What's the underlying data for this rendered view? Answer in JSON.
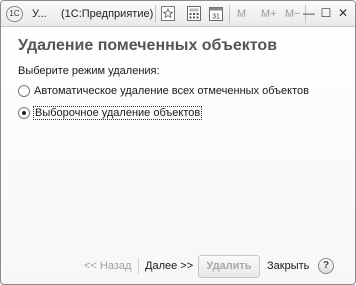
{
  "titlebar": {
    "logo": "1С",
    "short_title": "У...",
    "app_name": "(1С:Предприятие)",
    "m_label": "M",
    "m_plus_label": "M+",
    "m_minus_label": "M−",
    "min_symbol": "—",
    "max_symbol": "☐",
    "close_symbol": "✕",
    "icons": [
      "favorites-star-icon",
      "calculator-icon",
      "calendar-icon"
    ]
  },
  "main": {
    "heading": "Удаление помеченных объектов",
    "prompt": "Выберите режим удаления:",
    "options": [
      {
        "label": "Автоматическое удаление всех отмеченных объектов",
        "checked": false
      },
      {
        "label": "Выборочное удаление объектов",
        "checked": true
      }
    ]
  },
  "footer": {
    "back_label": "<< Назад",
    "next_label": "Далее >>",
    "delete_label": "Удалить",
    "close_label": "Закрыть",
    "help_label": "?"
  },
  "colors": {
    "heading": "#555555",
    "disabled": "#a0a0a0"
  }
}
